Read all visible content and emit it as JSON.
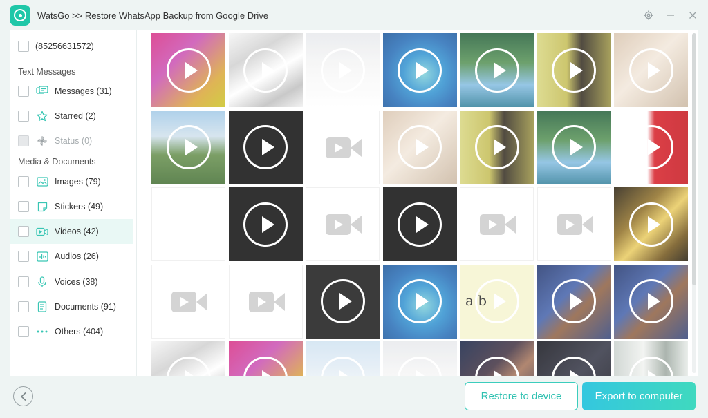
{
  "window": {
    "title": "WatsGo >> Restore WhatsApp Backup from Google Drive",
    "logo_icon": "watsgo-logo-icon",
    "accent": "#1fc7a8"
  },
  "sidebar": {
    "phone": "(85256631572)",
    "text_section": "Text Messages",
    "media_section": "Media & Documents",
    "items": [
      {
        "label": "Messages (31)",
        "icon": "message-icon",
        "enabled": true
      },
      {
        "label": "Starred (2)",
        "icon": "star-icon",
        "enabled": true
      },
      {
        "label": "Status (0)",
        "icon": "status-icon",
        "enabled": false
      },
      {
        "label": "Images (79)",
        "icon": "image-icon",
        "enabled": true
      },
      {
        "label": "Stickers (49)",
        "icon": "sticker-icon",
        "enabled": true
      },
      {
        "label": "Videos (42)",
        "icon": "video-icon",
        "enabled": true,
        "selected": true
      },
      {
        "label": "Audios (26)",
        "icon": "audio-icon",
        "enabled": true
      },
      {
        "label": "Voices (38)",
        "icon": "microphone-icon",
        "enabled": true
      },
      {
        "label": "Documents (91)",
        "icon": "document-icon",
        "enabled": true
      },
      {
        "label": "Others (404)",
        "icon": "more-icon",
        "enabled": true
      }
    ]
  },
  "grid": {
    "tiles": [
      {
        "kind": "pink-gradient"
      },
      {
        "kind": "silver-art"
      },
      {
        "kind": "screenshot"
      },
      {
        "kind": "ocean-island"
      },
      {
        "kind": "cartoon-lake"
      },
      {
        "kind": "portrait-yellow"
      },
      {
        "kind": "sketch-hand"
      },
      {
        "kind": "park"
      },
      {
        "kind": "black"
      },
      {
        "kind": "placeholder"
      },
      {
        "kind": "sketch-hand"
      },
      {
        "kind": "portrait-yellow"
      },
      {
        "kind": "cartoon-lake"
      },
      {
        "kind": "red-dragon"
      },
      {
        "kind": "placeholder-faint"
      },
      {
        "kind": "black"
      },
      {
        "kind": "placeholder"
      },
      {
        "kind": "black"
      },
      {
        "kind": "placeholder"
      },
      {
        "kind": "placeholder"
      },
      {
        "kind": "gold-abstract"
      },
      {
        "kind": "placeholder"
      },
      {
        "kind": "placeholder"
      },
      {
        "kind": "black-dark"
      },
      {
        "kind": "ocean-island"
      },
      {
        "kind": "handwriting"
      },
      {
        "kind": "news-anchor"
      },
      {
        "kind": "news-anchor"
      },
      {
        "kind": "silver-art"
      },
      {
        "kind": "pink-gradient"
      },
      {
        "kind": "screenshot-blue"
      },
      {
        "kind": "screenshot"
      },
      {
        "kind": "movie-scene"
      },
      {
        "kind": "dark-stage"
      },
      {
        "kind": "office"
      }
    ],
    "handwriting_text": "a b",
    "colors": {
      "pink-gradient": "linear-gradient(135deg,#d6287f 0%,#c84ab0 35%,#d8a431 75%,#c8c21c 100%)",
      "silver-art": "linear-gradient(150deg,#f5f5f5 0%,#cfcfcf 30%,#ffffff 55%,#bdbdbd 80%,#f0f0f0 100%)",
      "screenshot": "linear-gradient(180deg,#e7e9ec 0%,#f6f6f6 45%,#ffffff 100%)",
      "screenshot-blue": "linear-gradient(180deg,#cfe2f1 0%,#eef3f8 60%,#ffffff 100%)",
      "ocean-island": "radial-gradient(ellipse at 55% 55%,#7ccfd8 0%,#2b8fcf 35%,#1f68b4 65%,#124e94 100%)",
      "cartoon-lake": "linear-gradient(180deg,#1d5a33 0%,#4d8c4d 40%,#7fbadf 70%,#2c7c98 100%)",
      "portrait-yellow": "linear-gradient(90deg,#d6d47a 0%,#c2ba4f 40%,#2c2418 60%,#958d3a 100%)",
      "sketch-hand": "linear-gradient(135deg,#d8c3ad 0%,#f2e7da 45%,#c8b49d 100%)",
      "park": "linear-gradient(180deg,#9ec7e6 0%,#cfe0ec 35%,#5f8a45 60%,#3d6a2c 100%)",
      "black": "#050505",
      "black-dark": "#111111",
      "red-dragon": "linear-gradient(90deg,#ffffff 0%,#ffffff 45%,#d4151e 55%,#c30e17 100%)",
      "gold-abstract": "linear-gradient(135deg,#201707 0%,#8b6a1f 35%,#e8c95a 55%,#6b4d12 80%,#1b1405 100%)",
      "handwriting": "#f6f4cf",
      "news-anchor": "linear-gradient(135deg,#1a2f69 0%,#3c5ba6 40%,#8a5a3a 60%,#2a3d75 100%)",
      "movie-scene": "linear-gradient(135deg,#0d1b3e 0%,#3a2a3a 40%,#a06d52 60%,#1a2040 100%)",
      "dark-stage": "linear-gradient(135deg,#0b0c14 0%,#2b2d3d 50%,#0d0e16 100%)",
      "office": "linear-gradient(90deg,#c8d0cc 0%,#f0f2ef 40%,#9aa69e 70%,#e6ebe7 100%)"
    }
  },
  "footer": {
    "back_icon": "back-arrow-icon",
    "restore_label": "Restore to device",
    "export_label": "Export to computer"
  }
}
